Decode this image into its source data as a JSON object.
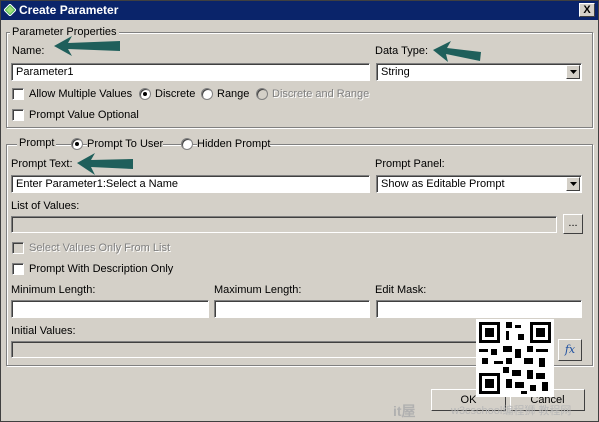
{
  "window": {
    "title": "Create Parameter",
    "close_label": "X"
  },
  "parameter_properties": {
    "legend": "Parameter Properties",
    "name_label": "Name:",
    "name_value": "Parameter1",
    "data_type_label": "Data Type:",
    "data_type_value": "String",
    "allow_multiple_label": "Allow Multiple Values",
    "discrete_label": "Discrete",
    "range_label": "Range",
    "discrete_range_label": "Discrete and Range",
    "prompt_optional_label": "Prompt Value Optional"
  },
  "prompt": {
    "legend": "Prompt",
    "prompt_to_user_label": "Prompt To User",
    "hidden_prompt_label": "Hidden Prompt",
    "prompt_text_label": "Prompt Text:",
    "prompt_text_value": "Enter Parameter1:Select a Name",
    "prompt_panel_label": "Prompt Panel:",
    "prompt_panel_value": "Show as Editable Prompt",
    "list_of_values_label": "List of Values:",
    "browse_label": "...",
    "select_from_list_label": "Select Values Only From List",
    "with_description_label": "Prompt With Description Only",
    "min_length_label": "Minimum Length:",
    "max_length_label": "Maximum Length:",
    "edit_mask_label": "Edit Mask:",
    "initial_values_label": "Initial Values:",
    "fx_label": "fx"
  },
  "buttons": {
    "ok_label": "OK",
    "cancel_label": "Cancel"
  },
  "watermark": {
    "site": "it屋",
    "text": "w3cschool编程狮 教程网"
  },
  "colors": {
    "titlebar": "#0a246a",
    "dialog_bg": "#d4d0c8",
    "arrow": "#1f5f5b"
  }
}
